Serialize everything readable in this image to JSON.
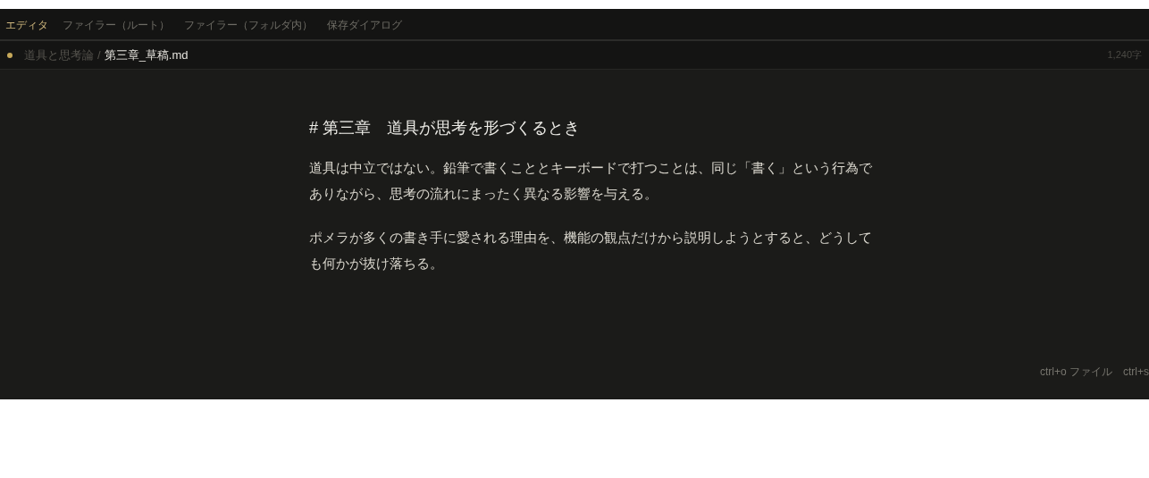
{
  "tabs": [
    {
      "label": "エディタ",
      "selected": true
    },
    {
      "label": "ファイラー（ルート）",
      "selected": false
    },
    {
      "label": "ファイラー（フォルダ内）",
      "selected": false
    },
    {
      "label": "保存ダイアログ",
      "selected": false
    }
  ],
  "file_bar": {
    "unsaved": true,
    "folder": "道具と思考論",
    "separator": "/",
    "file": "第三章_草稿.md",
    "char_count": "1,240字"
  },
  "document": {
    "heading": "# 第三章　道具が思考を形づくるとき",
    "paragraphs": [
      "道具は中立ではない。鉛筆で書くこととキーボードで打つことは、同じ「書く」という行為でありながら、思考の流れにまったく異なる影響を与える。",
      "ポメラが多くの書き手に愛される理由を、機能の観点だけから説明しようとすると、どうしても何かが抜け落ちる。"
    ]
  },
  "shortcut_hints": [
    "ctrl+o ファイル",
    "ctrl+s"
  ]
}
